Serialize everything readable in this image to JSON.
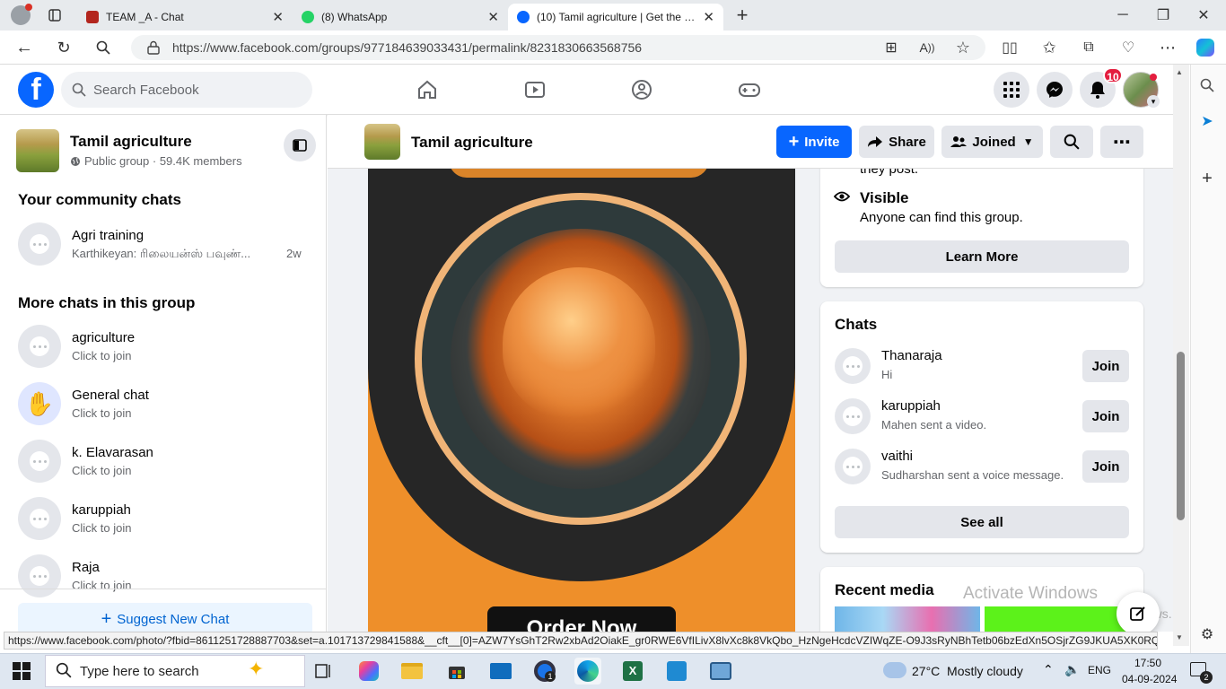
{
  "browser": {
    "tabs": [
      {
        "title": "TEAM _A - Chat",
        "icon": "chat-icon"
      },
      {
        "title": "(8) WhatsApp",
        "icon": "whatsapp-icon"
      },
      {
        "title": "(10) Tamil agriculture | Get the Fre",
        "icon": "facebook-icon",
        "active": true
      }
    ],
    "new_tab_label": "+",
    "url": "https://www.facebook.com/groups/977184639033431/permalink/8231830663568756"
  },
  "facebook": {
    "logo": "f",
    "search_placeholder": "Search Facebook",
    "notifications_count": "10"
  },
  "left_panel": {
    "group_name": "Tamil agriculture",
    "group_meta": "Public group · 59.4K members",
    "community_heading": "Your community chats",
    "community_chats": [
      {
        "name": "Agri training",
        "preview": "Karthikeyan: ரிலையன்ஸ் பவுண்...",
        "time": "2w"
      }
    ],
    "more_heading": "More chats in this group",
    "more_chats": [
      {
        "name": "agriculture",
        "sub": "Click to join"
      },
      {
        "name": "General chat",
        "sub": "Click to join"
      },
      {
        "name": "k. Elavarasan",
        "sub": "Click to join"
      },
      {
        "name": "karuppiah",
        "sub": "Click to join"
      },
      {
        "name": "Raja",
        "sub": "Click to join"
      }
    ],
    "suggest_label": "Suggest New Chat"
  },
  "group_header": {
    "name": "Tamil agriculture",
    "invite_label": "Invite",
    "share_label": "Share",
    "joined_label": "Joined"
  },
  "post": {
    "cta_label": "Order Now"
  },
  "about_card": {
    "top_text": "they post.",
    "visible_title": "Visible",
    "visible_desc": "Anyone can find this group.",
    "learn_more_label": "Learn More"
  },
  "chats_card": {
    "title": "Chats",
    "items": [
      {
        "name": "Thanaraja",
        "preview": "Hi",
        "button": "Join"
      },
      {
        "name": "karuppiah",
        "preview": "Mahen sent a video.",
        "button": "Join"
      },
      {
        "name": "vaithi",
        "preview": "Sudharshan sent a voice message.",
        "button": "Join"
      }
    ],
    "see_all_label": "See all"
  },
  "media_card": {
    "title": "Recent media"
  },
  "watermark": {
    "line1": "Activate Windows",
    "line2": "Windows."
  },
  "status_url": "https://www.facebook.com/photo/?fbid=861125172888770​3&set=a.101713729841588&__cft__[0]=AZW7YsGhT2Rw2xbAd2OiakE_gr0RWE6VfILivX8lvXc8k8VkQbo_HzNgeHcdcVZIWqZE-O9J3sRyNBhTetb06bzEdXn5OSjrZG9JKUA5XK0RQ9lcE6...",
  "taskbar": {
    "search_placeholder": "Type here to search",
    "weather": "27°C  Mostly cloudy",
    "language": "ENG",
    "time": "17:50",
    "date": "04-09-2024",
    "notification_count": "2",
    "app_badge": "1"
  }
}
